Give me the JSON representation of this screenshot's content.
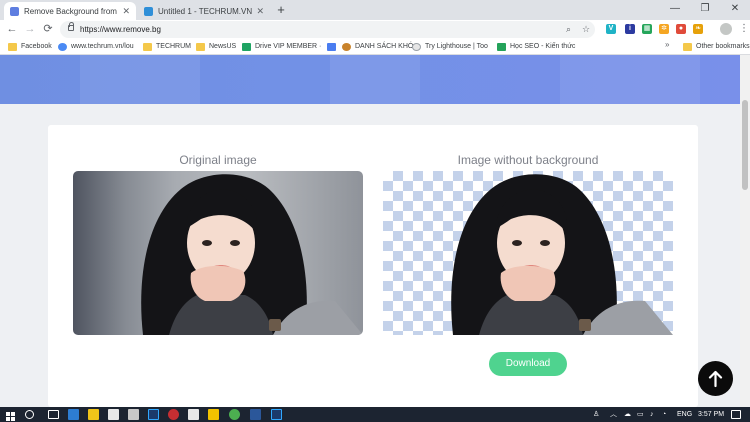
{
  "browser": {
    "tabs": [
      {
        "title": "Remove Background from Image",
        "active": true,
        "favicon_color": "#5e7ee0"
      },
      {
        "title": "Untitled 1 - TECHRUM.VN",
        "active": false,
        "favicon_color": "#2f8fd8"
      }
    ],
    "url": "https://www.remove.bg",
    "window_controls": {
      "minimize": "—",
      "maximize": "❐",
      "close": "✕"
    },
    "extensions": [
      {
        "name": "extension-v",
        "color": "#1fb3c6",
        "label": "V"
      },
      {
        "name": "extension-info",
        "color": "#2c3aa0",
        "label": "i"
      },
      {
        "name": "extension-grid",
        "color": "#26a65b",
        "label": "▦"
      },
      {
        "name": "extension-settings",
        "color": "#f5a623",
        "label": "✲"
      },
      {
        "name": "extension-red",
        "color": "#e04b3a",
        "label": "●"
      },
      {
        "name": "extension-leaf",
        "color": "#e6a10a",
        "label": "❧"
      }
    ]
  },
  "bookmarks": [
    {
      "label": "Facebook",
      "icon": "folder"
    },
    {
      "label": "www.techrum.vn/lou",
      "icon": "page"
    },
    {
      "label": "TECHRUM",
      "icon": "folder"
    },
    {
      "label": "NewsUS",
      "icon": "folder"
    },
    {
      "label": "Drive VIP MEMBER ·",
      "icon": "drive"
    },
    {
      "label": "",
      "icon": "doc"
    },
    {
      "label": "DANH SÁCH KHÓ",
      "icon": "key"
    },
    {
      "label": "Try Lighthouse | Too",
      "icon": "lighthouse"
    },
    {
      "label": "Học SEO - Kiến thức",
      "icon": "sheet"
    }
  ],
  "other_bookmarks": "Other bookmarks",
  "page": {
    "original_label": "Original image",
    "nobg_label": "Image without background",
    "download_label": "Download"
  },
  "taskbar": {
    "language": "ENG",
    "time": "3:57 PM"
  },
  "colors": {
    "hero": "#7291e6",
    "download": "#4fd38f",
    "checker": "#c4d2ea",
    "taskbar": "#1c2431"
  }
}
